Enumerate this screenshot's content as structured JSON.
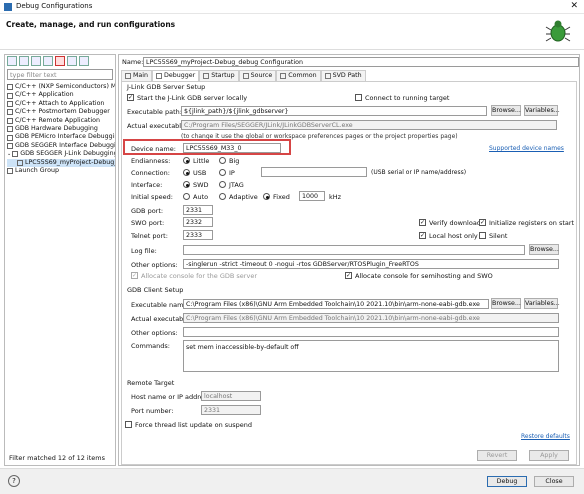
{
  "window": {
    "title": "Debug Configurations",
    "header": "Create, manage, and run configurations"
  },
  "left": {
    "filter_placeholder": "type filter text",
    "tree": [
      "C/C++ (NXP Semiconductors) M",
      "C/C++ Application",
      "C/C++ Attach to Application",
      "C/C++ Postmortem Debugger",
      "C/C++ Remote Application",
      "GDB Hardware Debugging",
      "GDB PEMicro Interface Debuggin",
      "GDB SEGGER Interface Debuggin",
      "GDB SEGGER J-Link Debugging",
      "LPC55S69_myProject-Debug_",
      "Launch Group"
    ],
    "status": "Filter matched 12 of 12 items"
  },
  "config": {
    "name_label": "Name:",
    "name": "LPC55S69_myProject-Debug_debug Configuration",
    "tabs": [
      "Main",
      "Debugger",
      "Startup",
      "Source",
      "Common",
      "SVD Path"
    ],
    "jlink_group": "J-Link GDB Server Setup",
    "start_locally": "Start the J-Link GDB server locally",
    "connect_running": "Connect to running target",
    "exec_path_label": "Executable path:",
    "exec_path": "${jlink_path}/${jlink_gdbserver}",
    "browse": "Browse...",
    "variables": "Variables...",
    "actual_exec_label": "Actual executable:",
    "actual_exec": "C:/Program Files/SEGGER/JLink/JLinkGDBServerCL.exe",
    "hint": "(to change it use the global or workspace preferences pages or the project properties page)",
    "device_label": "Device name:",
    "device": "LPC55S69_M33_0",
    "supported": "Supported device names",
    "endianness_label": "Endianness:",
    "little": "Little",
    "big": "Big",
    "connection_label": "Connection:",
    "usb": "USB",
    "ip": "IP",
    "usb_hint": "(USB serial or IP name/address)",
    "interface_label": "Interface:",
    "swd": "SWD",
    "jtag": "JTAG",
    "speed_label": "Initial speed:",
    "auto": "Auto",
    "adaptive": "Adaptive",
    "fixed": "Fixed",
    "speed": "1000",
    "khz": "kHz",
    "gdb_port_label": "GDB port:",
    "gdb_port": "2331",
    "swo_port_label": "SWO port:",
    "swo_port": "2332",
    "telnet_port_label": "Telnet port:",
    "telnet_port": "2333",
    "verify": "Verify downloads",
    "init_regs": "Initialize registers on start",
    "local_host": "Local host only",
    "silent": "Silent",
    "log_label": "Log file:",
    "other_label": "Other options:",
    "other": "-singlerun -strict -timeout 0 -nogui -rtos GDBServer/RTOSPlugin_FreeRTOS",
    "alloc_gdb": "Allocate console for the GDB server",
    "alloc_semi": "Allocate console for semihosting and SWO",
    "client_group": "GDB Client Setup",
    "client_exec_label": "Executable name:",
    "client_exec": "C:\\Program Files (x86)\\GNU Arm Embedded Toolchain\\10 2021.10\\bin\\arm-none-eabi-gdb.exe",
    "client_actual": "C:\\Program Files (x86)\\GNU Arm Embedded Toolchain\\10 2021.10\\bin\\arm-none-eabi-gdb.exe",
    "client_other_label": "Other options:",
    "commands_label": "Commands:",
    "commands": "set mem inaccessible-by-default off",
    "remote_group": "Remote Target",
    "host_label": "Host name or IP address:",
    "host": "localhost",
    "port_label": "Port number:",
    "port": "2331",
    "force_thread": "Force thread list update on suspend",
    "restore": "Restore defaults",
    "revert": "Revert",
    "apply": "Apply"
  },
  "bottom": {
    "help": "?",
    "debug": "Debug",
    "close": "Close"
  }
}
